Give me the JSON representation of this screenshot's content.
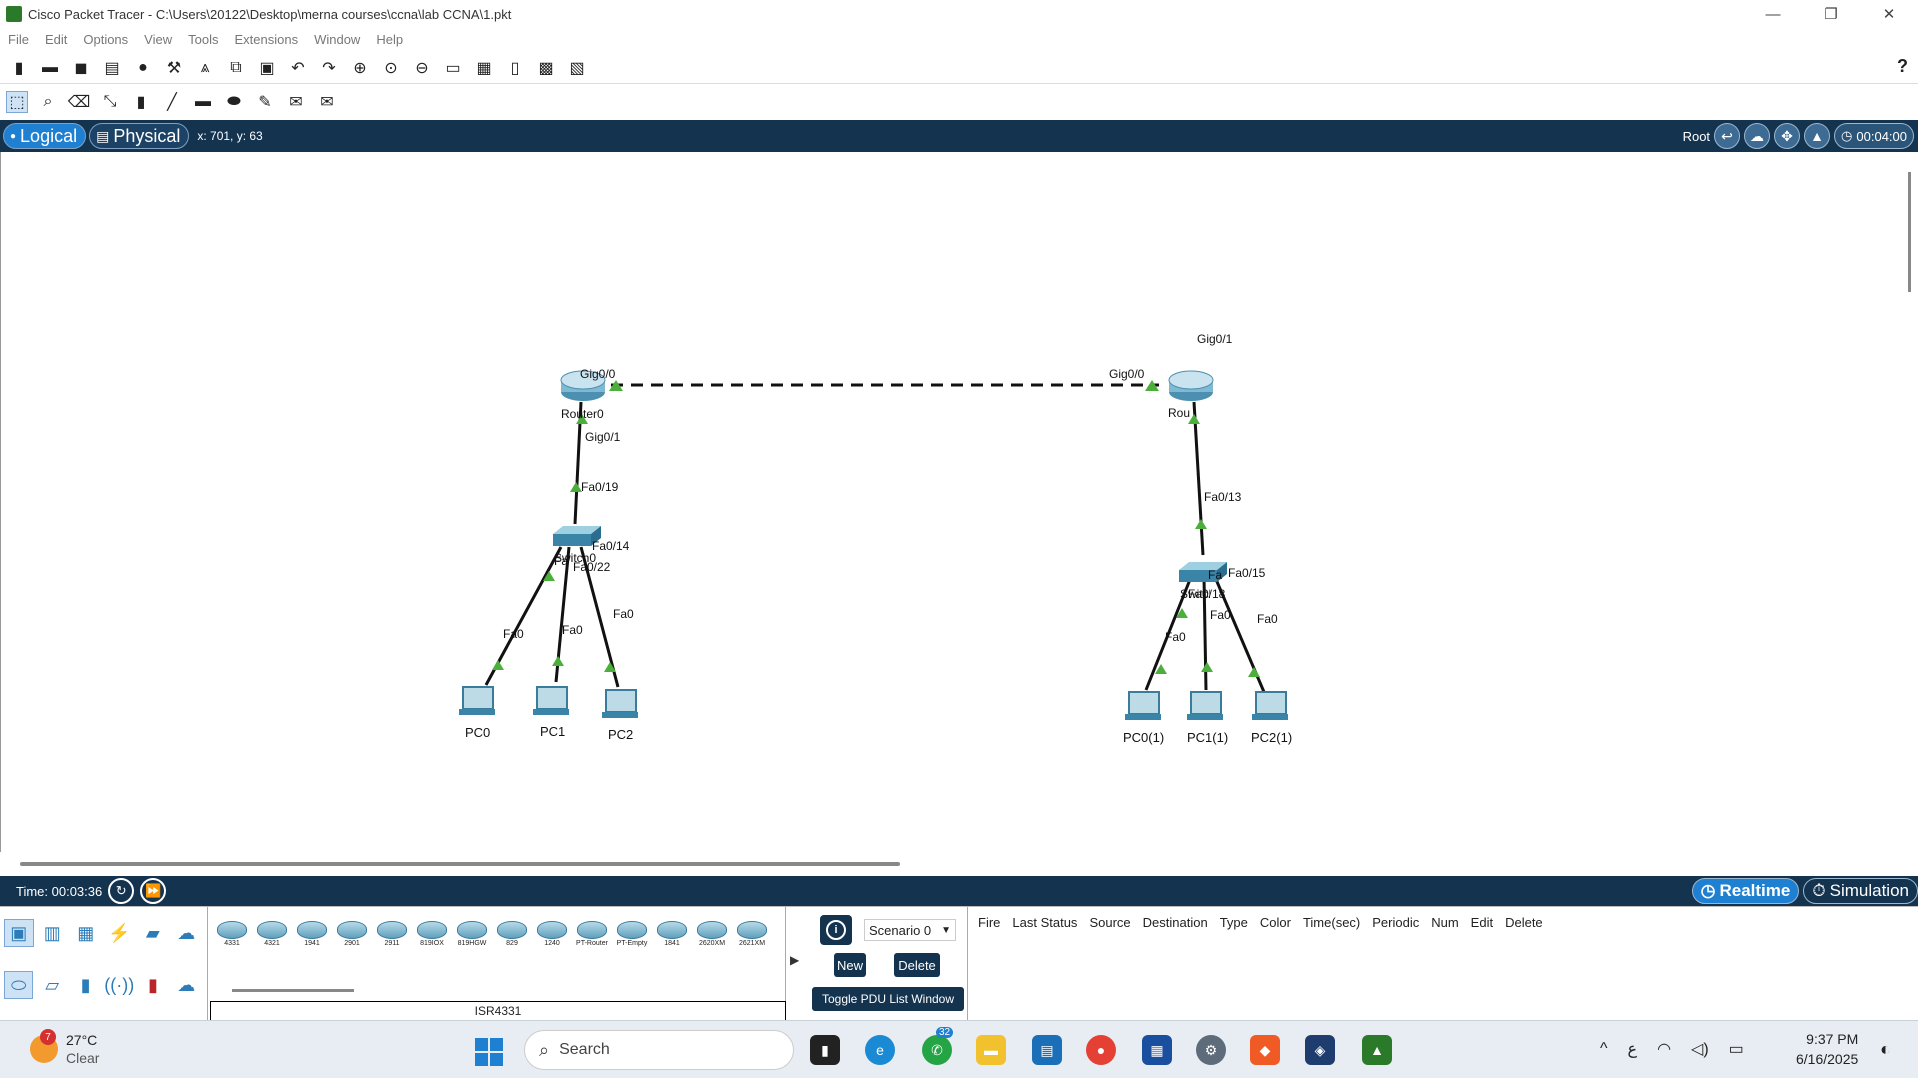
{
  "window": {
    "title": "Cisco Packet Tracer - C:\\Users\\20122\\Desktop\\merna courses\\ccna\\lab CCNA\\1.pkt",
    "minimize": "—",
    "restore": "❐",
    "close": "✕"
  },
  "menu": [
    "File",
    "Edit",
    "Options",
    "View",
    "Tools",
    "Extensions",
    "Window",
    "Help"
  ],
  "toolbar1_icons": [
    "new-file-icon",
    "open-icon",
    "save-icon",
    "print-icon",
    "info-icon",
    "custom-devices-icon",
    "activity-wizard-icon",
    "copy-icon",
    "paste-icon",
    "undo-icon",
    "redo-icon",
    "zoom-in-icon",
    "zoom-reset-icon",
    "zoom-out-icon",
    "drawing-palette-icon",
    "custom-device-icon",
    "pdu-list-icon",
    "viewport-icon",
    "screenshot-icon"
  ],
  "toolbar2_icons": [
    "select-icon",
    "inspect-icon",
    "delete-icon",
    "resize-icon",
    "note-icon",
    "line-icon",
    "rectangle-icon",
    "ellipse-icon",
    "freeform-icon",
    "simple-pdu-icon",
    "complex-pdu-icon"
  ],
  "help_label": "?",
  "nav": {
    "logical": "Logical",
    "physical": "Physical",
    "coords": "x: 701, y: 63",
    "root": "Root",
    "time": "00:04:00"
  },
  "topology": {
    "devices": [
      {
        "id": "router0",
        "label": "Router0"
      },
      {
        "id": "router1",
        "label": "Rou"
      },
      {
        "id": "switch0",
        "label": "Switch0"
      },
      {
        "id": "switch1",
        "label": "Switch1"
      },
      {
        "id": "pc0",
        "label": "PC0"
      },
      {
        "id": "pc1",
        "label": "PC1"
      },
      {
        "id": "pc2",
        "label": "PC2"
      },
      {
        "id": "pc0b",
        "label": "PC0(1)"
      },
      {
        "id": "pc1b",
        "label": "PC1(1)"
      },
      {
        "id": "pc2b",
        "label": "PC2(1)"
      }
    ],
    "ports": {
      "r0_g00": "Gig0/0",
      "r1_g00": "Gig0/0",
      "r0_g01": "Gig0/1",
      "r1_g01": "Gig0/1",
      "s0_fa019": "Fa0/19",
      "s1_fa013": "Fa0/13",
      "s0_fa014": "Fa0/14",
      "s0_fa022": "Fa0/22",
      "s0_fa": "Fa",
      "s1_fa015": "Fa0/15",
      "s1_fa018": "Fa0/18",
      "s1_fa": "Fa",
      "pc0_fa0": "Fa0",
      "pc1_fa0": "Fa0",
      "pc2_fa0": "Fa0",
      "pc0b_fa0": "Fa0",
      "pc1b_fa0": "Fa0",
      "pc2b_fa0": "Fa0"
    }
  },
  "timebar": {
    "time": "Time: 00:03:36",
    "realtime": "Realtime",
    "simulation": "Simulation"
  },
  "devices_panel": {
    "models": [
      "4331",
      "4321",
      "1941",
      "2901",
      "2911",
      "819IOX",
      "819HGW",
      "829",
      "1240",
      "PT-Router",
      "PT-Empty",
      "1841",
      "2620XM",
      "2621XM"
    ],
    "selected_model": "ISR4331"
  },
  "scenario": {
    "select": "Scenario 0",
    "new": "New",
    "delete": "Delete",
    "toggle": "Toggle PDU List Window"
  },
  "pdu_columns": [
    "Fire",
    "Last Status",
    "Source",
    "Destination",
    "Type",
    "Color",
    "Time(sec)",
    "Periodic",
    "Num",
    "Edit",
    "Delete"
  ],
  "taskbar": {
    "weather_temp": "27°C",
    "weather_desc": "Clear",
    "weather_badge": "7",
    "search": "Search",
    "whatsapp_badge": "32",
    "lang": "ع",
    "time": "9:37 PM",
    "date": "6/16/2025"
  }
}
